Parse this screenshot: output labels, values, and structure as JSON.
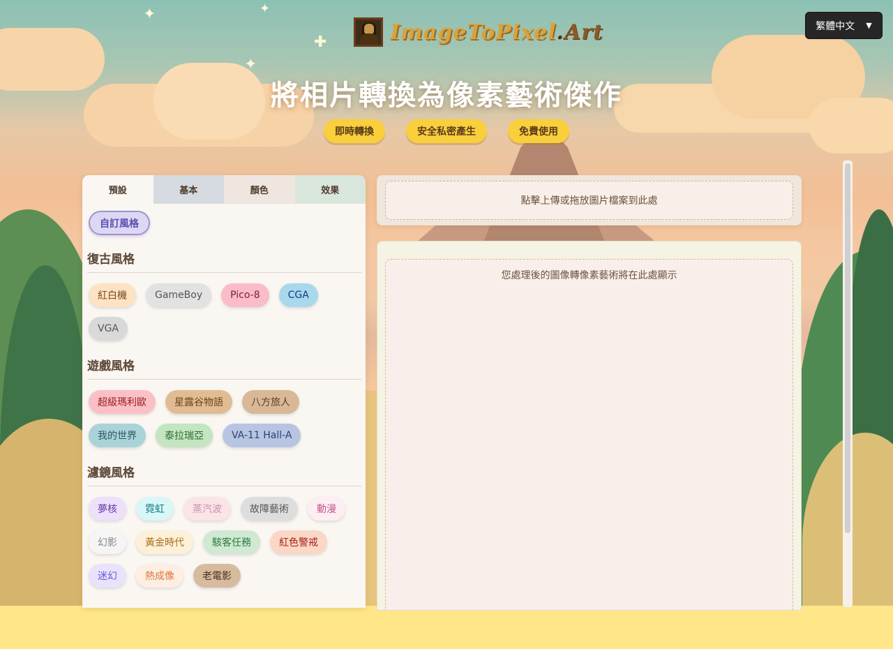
{
  "brand": {
    "name_main": "ImageToPixel",
    "name_dot": ".",
    "name_tld": "Art",
    "logo_icon": "mona-lisa-icon"
  },
  "language": {
    "label": "繁體中文",
    "caret": "▼"
  },
  "hero": {
    "title": "將相片轉換為像素藝術傑作",
    "features": [
      "即時轉換",
      "安全私密產生",
      "免費使用"
    ]
  },
  "tabs": [
    "預設",
    "基本",
    "顏色",
    "效果"
  ],
  "custom_style_label": "自訂風格",
  "sections": [
    {
      "title": "復古風格",
      "chips": [
        {
          "label": "紅白機",
          "bg": "#fde3c4",
          "fg": "#7a4a1a"
        },
        {
          "label": "GameBoy",
          "bg": "#e2e2e2",
          "fg": "#555555"
        },
        {
          "label": "Pico-8",
          "bg": "#f9bcc8",
          "fg": "#7a1e33"
        },
        {
          "label": "CGA",
          "bg": "#a9d8ec",
          "fg": "#0e3a86"
        },
        {
          "label": "VGA",
          "bg": "#d9d9d9",
          "fg": "#555555"
        }
      ]
    },
    {
      "title": "遊戲風格",
      "chips": [
        {
          "label": "超級瑪利歐",
          "bg": "#fac0c6",
          "fg": "#9a1c25"
        },
        {
          "label": "星露谷物語",
          "bg": "#e1bc92",
          "fg": "#6a4420"
        },
        {
          "label": "八方旅人",
          "bg": "#d8b896",
          "fg": "#5e4026"
        },
        {
          "label": "我的世界",
          "bg": "#a9d3d9",
          "fg": "#2f5560"
        },
        {
          "label": "泰拉瑞亞",
          "bg": "#c3e5c0",
          "fg": "#2f6b33"
        },
        {
          "label": "VA-11 Hall-A",
          "bg": "#b7c5e3",
          "fg": "#2f3f6e"
        }
      ]
    },
    {
      "title": "濾鏡風格",
      "chips": [
        {
          "label": "夢核",
          "bg": "#ede0fb",
          "fg": "#6b3aa8"
        },
        {
          "label": "霓虹",
          "bg": "#daf7f8",
          "fg": "#0e7c86"
        },
        {
          "label": "蒸汽波",
          "bg": "#fbe4e4",
          "fg": "#c98fbd"
        },
        {
          "label": "故障藝術",
          "bg": "#dddddd",
          "fg": "#555555"
        },
        {
          "label": "動漫",
          "bg": "#fdeef3",
          "fg": "#c45a86"
        },
        {
          "label": "幻影",
          "bg": "#f5f5f5",
          "fg": "#888888"
        },
        {
          "label": "黃金時代",
          "bg": "#fdf0d8",
          "fg": "#a7701a"
        },
        {
          "label": "駭客任務",
          "bg": "#cfe9d3",
          "fg": "#2a7a3a"
        },
        {
          "label": "紅色警戒",
          "bg": "#fbd7c6",
          "fg": "#a3211c"
        },
        {
          "label": "迷幻",
          "bg": "#e8e3fb",
          "fg": "#6b5ad6"
        },
        {
          "label": "熱成像",
          "bg": "#fdeee4",
          "fg": "#e0763a"
        },
        {
          "label": "老電影",
          "bg": "#d7bb9e",
          "fg": "#4b3320"
        }
      ]
    }
  ],
  "upload": {
    "prompt": "點擊上傳或拖放圖片檔案到此處"
  },
  "output": {
    "placeholder": "您處理後的圖像轉像素藝術將在此處顯示"
  }
}
